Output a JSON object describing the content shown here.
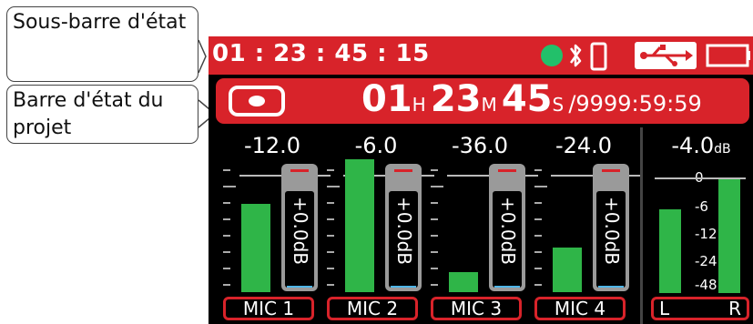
{
  "callouts": {
    "sub_bar": "Sous-barre d'état",
    "project_bar": "Barre d'état du projet"
  },
  "sub_bar": {
    "timecode": "01 : 23 : 45 : 15",
    "icons": [
      "status-dot-icon",
      "bluetooth-icon",
      "phone-icon",
      "usb-icon",
      "battery-icon"
    ],
    "dot_color": "#22c06a"
  },
  "project_bar": {
    "hours": "01",
    "hours_unit": "H",
    "minutes": "23",
    "minutes_unit": "M",
    "seconds": "45",
    "seconds_unit": "S",
    "remaining": "/9999:59:59"
  },
  "channels": [
    {
      "label": "MIC 1",
      "level": "-12.0",
      "gain": "+0.0dB",
      "meter": 0.36
    },
    {
      "label": "MIC 2",
      "level": "-6.0",
      "gain": "+0.0dB",
      "meter": 0.54
    },
    {
      "label": "MIC 3",
      "level": "-36.0",
      "gain": "+0.0dB",
      "meter": 0.08
    },
    {
      "label": "MIC 4",
      "level": "-24.0",
      "gain": "+0.0dB",
      "meter": 0.18
    }
  ],
  "master": {
    "level": "-4.0",
    "unit": "dB",
    "left_label": "L",
    "right_label": "R",
    "left_meter": 0.54,
    "right_meter": 0.74,
    "scale": [
      "0",
      "-6",
      "-12",
      "-24",
      "-48"
    ]
  },
  "colors": {
    "accent": "#d8232a",
    "meter": "#2fb548",
    "background": "#000000"
  }
}
